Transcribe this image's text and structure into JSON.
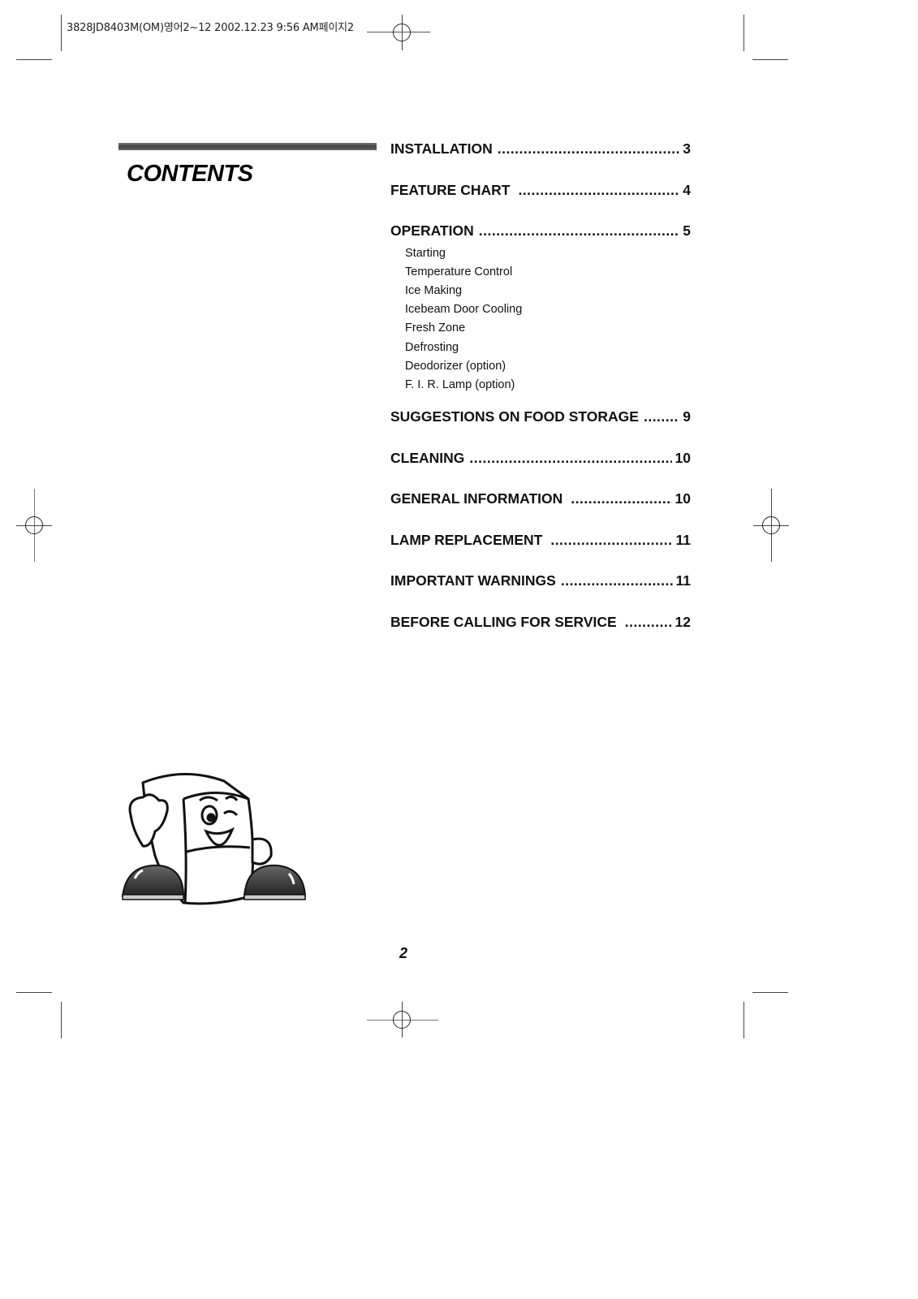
{
  "print_slug": "3828JD8403M(OM)영어2~12  2002.12.23 9:56 AM페이지2",
  "title": "CONTENTS",
  "toc": [
    {
      "label": "INSTALLATION",
      "page": "3"
    },
    {
      "label": "FEATURE CHART",
      "page": "4"
    },
    {
      "label": "OPERATION",
      "page": "5",
      "subitems": [
        "Starting",
        "Temperature Control",
        "Ice Making",
        "Icebeam Door Cooling",
        "Fresh Zone",
        "Defrosting",
        "Deodorizer (option)",
        "F. I. R. Lamp (option)"
      ]
    },
    {
      "label": "SUGGESTIONS ON FOOD STORAGE",
      "page": "9"
    },
    {
      "label": "CLEANING",
      "page": "10"
    },
    {
      "label": "GENERAL INFORMATION",
      "page": "10"
    },
    {
      "label": "LAMP REPLACEMENT",
      "page": "11"
    },
    {
      "label": "IMPORTANT WARNINGS",
      "page": "11"
    },
    {
      "label": "BEFORE CALLING FOR SERVICE",
      "page": "12"
    }
  ],
  "illustration": "refrigerator-mascot-winking",
  "page_number": "2"
}
